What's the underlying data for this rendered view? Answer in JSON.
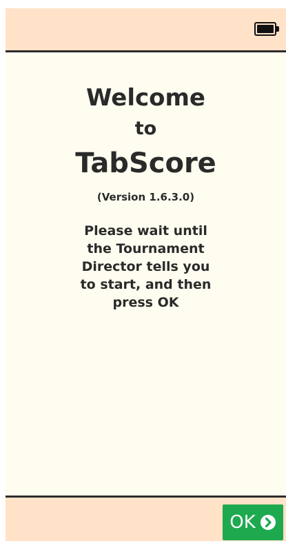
{
  "header": {
    "battery_icon": "battery-full-icon"
  },
  "main": {
    "welcome": "Welcome",
    "to": "to",
    "app_name": "TabScore",
    "version": "(Version 1.6.3.0)",
    "instructions": "Please wait until the Tournament Director tells you to start, and then press OK"
  },
  "footer": {
    "ok_label": "OK",
    "ok_icon": "chevron-circle-right-icon",
    "button_color": "#1ea94f"
  },
  "colors": {
    "header_bg": "#ffe2c8",
    "main_bg": "#fffdf0",
    "text": "#2a2a2a",
    "divider": "#2b2b2b"
  }
}
